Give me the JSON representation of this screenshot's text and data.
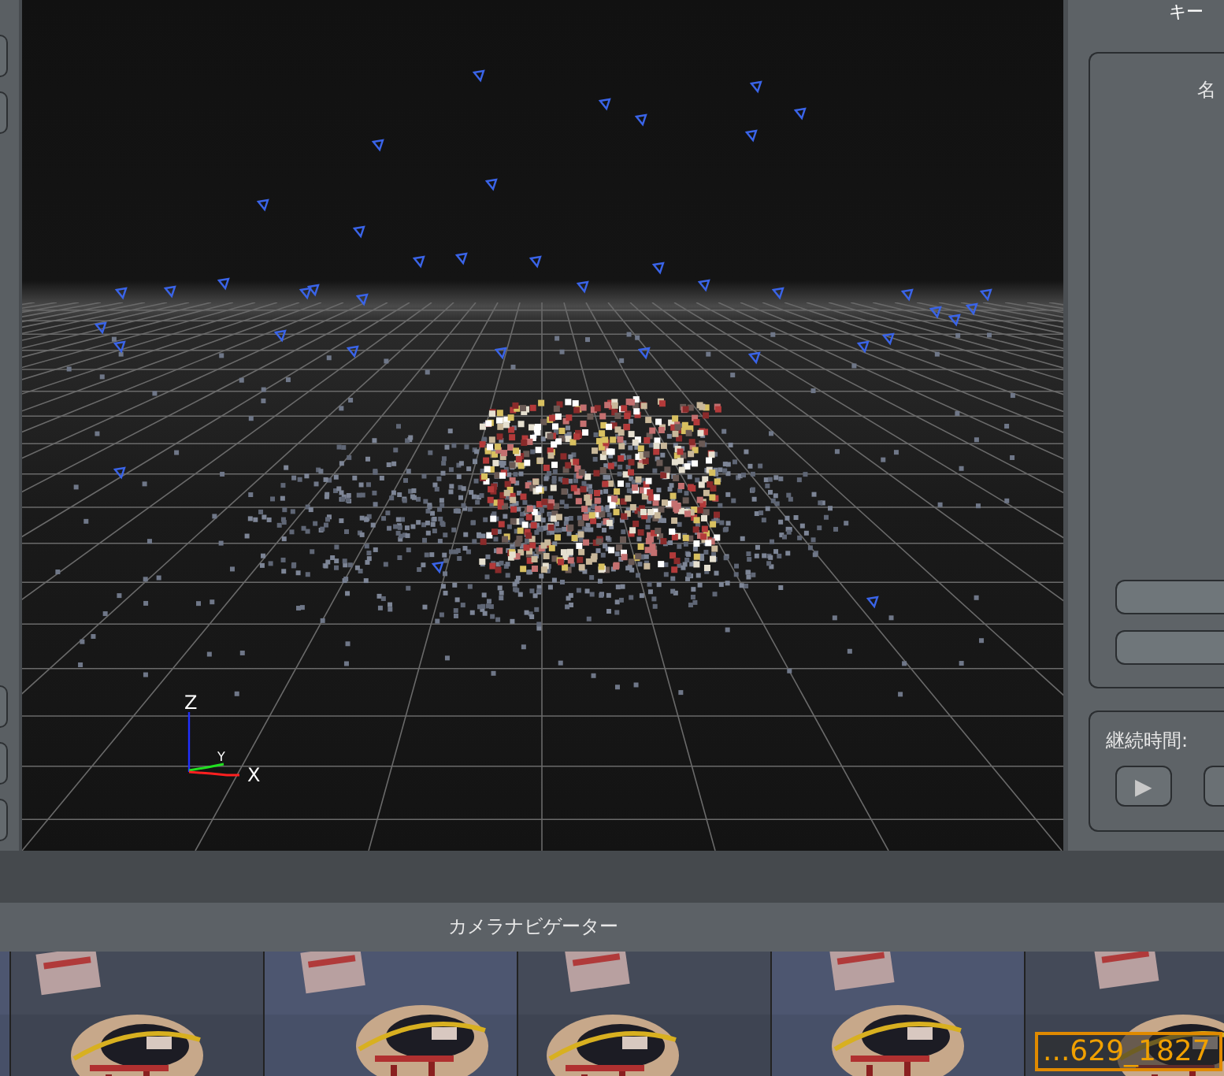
{
  "right_panel": {
    "title": "キー",
    "name_label": "名",
    "duration_label": "継続時間:",
    "play_button": "▶"
  },
  "viewport": {
    "axis_labels": {
      "z": "Z",
      "y": "Y",
      "x": "X"
    }
  },
  "camera_navigator": {
    "title": "カメラナビゲーター",
    "overlay_label": "...629_1827"
  }
}
